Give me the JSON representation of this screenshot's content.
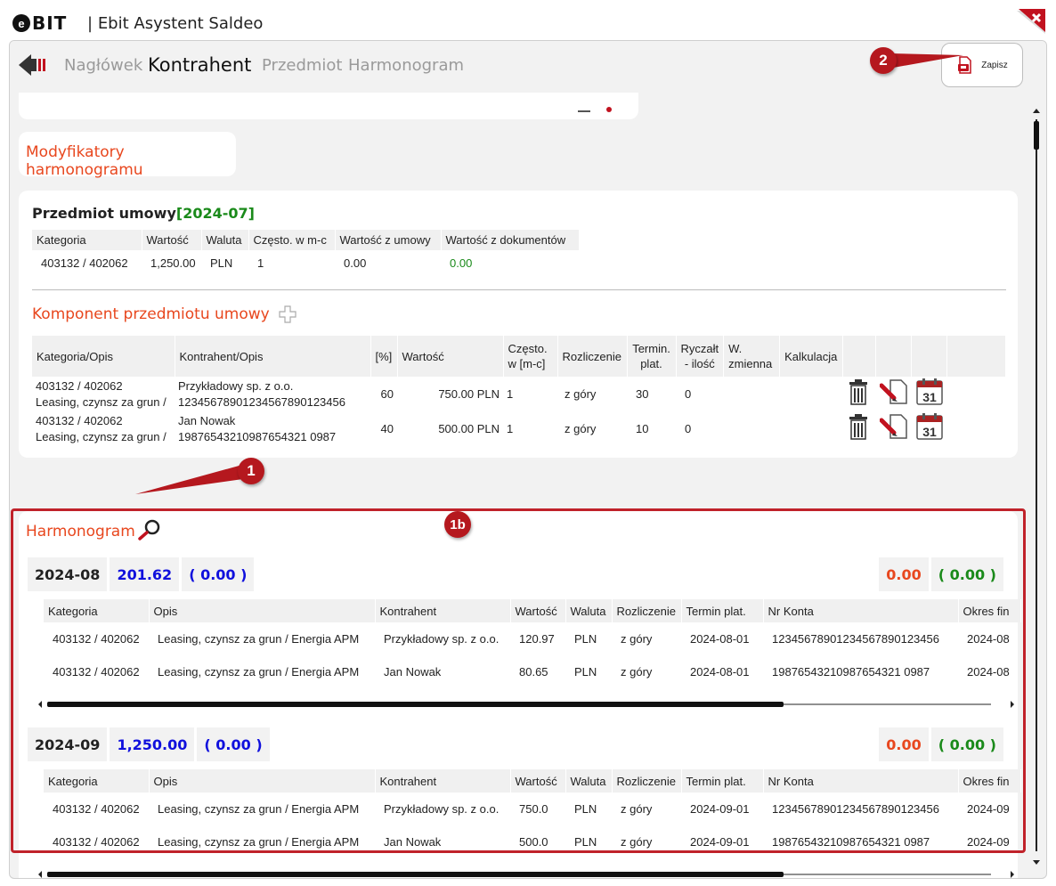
{
  "app": {
    "logo_letter": "e",
    "logo_text": "BIT",
    "separator": "|",
    "title": "Ebit Asystent Saldeo"
  },
  "nav": {
    "tabs": [
      {
        "label": "Nagłówek",
        "active": false
      },
      {
        "label": "Kontrahent",
        "active": true
      },
      {
        "label": "Przedmiot",
        "active": false
      },
      {
        "label": "Harmonogram",
        "active": false
      }
    ],
    "save_label": "Zapisz"
  },
  "annotations": {
    "badge_1": "1",
    "badge_2": "2",
    "badge_1b": "1b"
  },
  "modifiers": {
    "title": "Modyfikatory harmonogramu"
  },
  "subject": {
    "title": "Przedmiot umowy",
    "period": "[2024-07]",
    "headers": [
      "Kategoria",
      "Wartość",
      "Waluta",
      "Często. w m-c",
      "Wartość z umowy",
      "Wartość z dokumentów"
    ],
    "row": [
      "403132 / 402062",
      "1,250.00",
      "PLN",
      "1",
      "0.00",
      "0.00"
    ]
  },
  "components": {
    "title": "Komponent przedmiotu umowy",
    "headers": {
      "kategoria": "Kategoria/Opis",
      "kontrahent": "Kontrahent/Opis",
      "procent": "[%]",
      "wartosc": "Wartość",
      "czesto_1": "Często.",
      "czesto_2": "w [m-c]",
      "rozliczenie": "Rozliczenie",
      "termin_1": "Termin.",
      "termin_2": "plat.",
      "ryczalt_1": "Ryczałt",
      "ryczalt_2": "- ilość",
      "wzmienna_1": "W.",
      "wzmienna_2": "zmienna",
      "kalkulacja": "Kalkulacja"
    },
    "rows": [
      {
        "kategoria": "403132 / 402062",
        "opis": "Leasing, czynsz za grun /",
        "kontrahent": "Przykładowy sp. z o.o.",
        "konto": "12345678901234567890123456",
        "procent": "60",
        "wartosc": "750.00 PLN",
        "czesto": "1",
        "rozliczenie": "z góry",
        "termin": "30",
        "ryczalt": "0",
        "calendar_day": "31"
      },
      {
        "kategoria": "403132 / 402062",
        "opis": "Leasing, czynsz za grun /",
        "kontrahent": "Jan Nowak",
        "konto": "19876543210987654321 0987",
        "procent": "40",
        "wartosc": "500.00 PLN",
        "czesto": "1",
        "rozliczenie": "z góry",
        "termin": "10",
        "ryczalt": "0",
        "calendar_day": "31"
      }
    ]
  },
  "schedule": {
    "title": "Harmonogram",
    "headers": [
      "Kategoria",
      "Opis",
      "Kontrahent",
      "Wartość",
      "Waluta",
      "Rozliczenie",
      "Termin plat.",
      "Nr Konta",
      "Okres fin"
    ],
    "headers_2": [
      "Kategoria",
      "Opis",
      "Kontrahent",
      "Wartość",
      "Waluta",
      "Rozliczenie",
      "Termin plat.",
      "Nr Konta",
      "Okres fin"
    ],
    "months": [
      {
        "period": "2024-08",
        "sum": "201.62",
        "doc_sum": "( 0.00 )",
        "right_value": "0.00",
        "right_doc": "( 0.00 )",
        "rows": [
          [
            "403132 / 402062",
            "Leasing, czynsz za grun / Energia APM",
            "Przykładowy sp. z o.o.",
            "120.97",
            "PLN",
            "z góry",
            "2024-08-01",
            "12345678901234567890123456",
            "2024-08"
          ],
          [
            "403132 / 402062",
            "Leasing, czynsz za grun / Energia APM",
            "Jan Nowak",
            "80.65",
            "PLN",
            "z góry",
            "2024-08-01",
            "19876543210987654321 0987",
            "2024-08"
          ]
        ],
        "scroll_fraction": 0.78
      },
      {
        "period": "2024-09",
        "sum": "1,250.00",
        "doc_sum": "( 0.00 )",
        "right_value": "0.00",
        "right_doc": "( 0.00 )",
        "rows": [
          [
            "403132 / 402062",
            "Leasing, czynsz za grun / Energia APM",
            "Przykładowy sp. z o.o.",
            "750.0",
            "PLN",
            "z góry",
            "2024-09-01",
            "12345678901234567890123456",
            "2024-09"
          ],
          [
            "403132 / 402062",
            "Leasing, czynsz za grun / Energia APM",
            "Jan Nowak",
            "500.0",
            "PLN",
            "z góry",
            "2024-09-01",
            "19876543210987654321 0987",
            "2024-09"
          ]
        ],
        "scroll_fraction": 0.78
      }
    ]
  },
  "colors": {
    "accent": "#e8471e",
    "annotation_red": "#b5181e",
    "positive_green": "#1a8a1a",
    "sum_blue": "#1010dd"
  }
}
